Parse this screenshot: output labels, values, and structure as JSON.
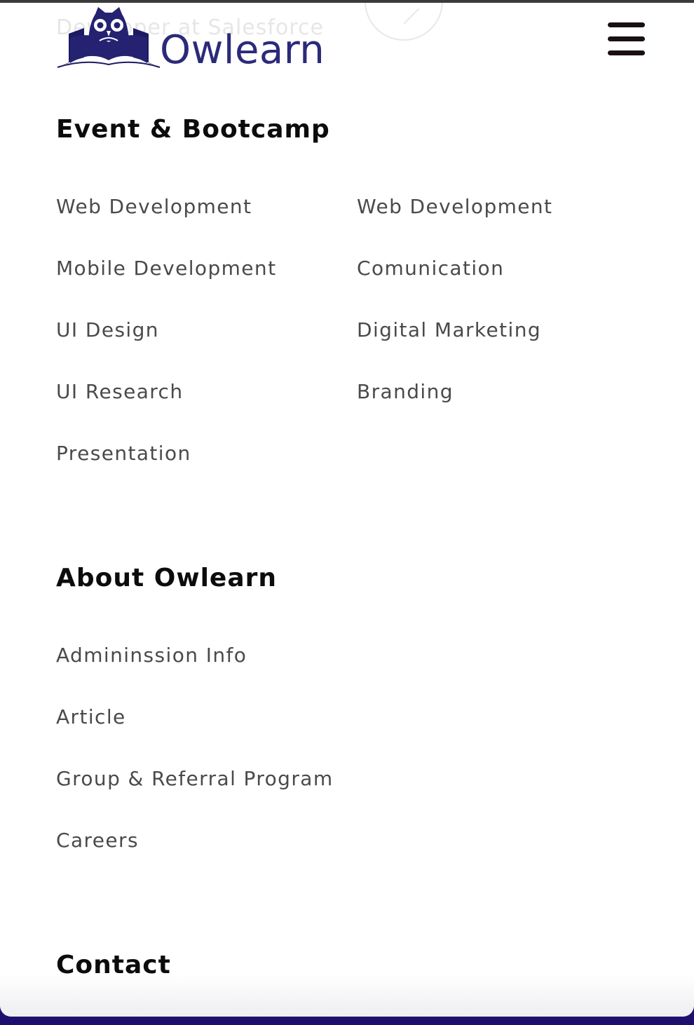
{
  "brand": {
    "name": "Owlearn",
    "color": "#2b2a7a"
  },
  "background_overlay": {
    "text": "Developer at Salesforce"
  },
  "header": {
    "menu_icon": "hamburger-menu-icon"
  },
  "sections": {
    "event_bootcamp": {
      "title": "Event & Bootcamp",
      "left_links": [
        "Web Development",
        "Mobile Development",
        "UI Design",
        "UI Research",
        "Presentation"
      ],
      "right_links": [
        "Web Development",
        "Comunication",
        "Digital Marketing",
        "Branding"
      ]
    },
    "about": {
      "title": "About Owlearn",
      "links": [
        "Admininssion Info",
        "Article",
        "Group & Referral Program",
        "Careers"
      ]
    },
    "contact": {
      "title": "Contact"
    }
  },
  "colors": {
    "heading": "#0c0c0c",
    "link": "#4a4a4a",
    "page_edge": "#1e0f6e"
  }
}
